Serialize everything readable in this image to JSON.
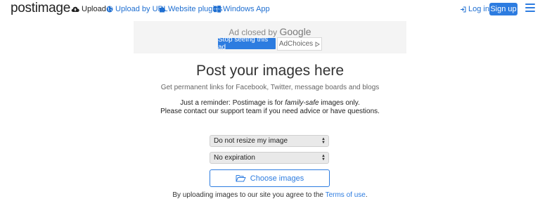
{
  "header": {
    "logo": "postimage",
    "nav": [
      {
        "label": "Upload",
        "icon": "cloud-upload-icon"
      },
      {
        "label": "Upload by URL",
        "icon": "globe-icon"
      },
      {
        "label": "Website plugins",
        "icon": "puzzle-icon"
      },
      {
        "label": "Windows App",
        "icon": "windows-icon"
      }
    ],
    "login_label": "Log in",
    "signup_label": "Sign up"
  },
  "ad": {
    "closed_text": "Ad closed by",
    "closed_brand": "Google",
    "stop_button": "Stop seeing this ad",
    "adchoices_button": "AdChoices"
  },
  "main": {
    "title": "Post your images here",
    "subtitle": "Get permanent links for Facebook, Twitter, message boards and blogs",
    "reminder_prefix": "Just a reminder: Postimage is for",
    "reminder_emphasis": "family-safe",
    "reminder_suffix": "images only.",
    "reminder_line2": "Please contact our support team if you need advice or have questions.",
    "resize_select": "Do not resize my image",
    "expiration_select": "No expiration",
    "choose_button": "Choose images",
    "terms_prefix": "By uploading images to our site you agree to the",
    "terms_link": "Terms of use",
    "terms_suffix": "."
  },
  "colors": {
    "accent": "#2d7ce0",
    "link": "#1f6fd1"
  }
}
